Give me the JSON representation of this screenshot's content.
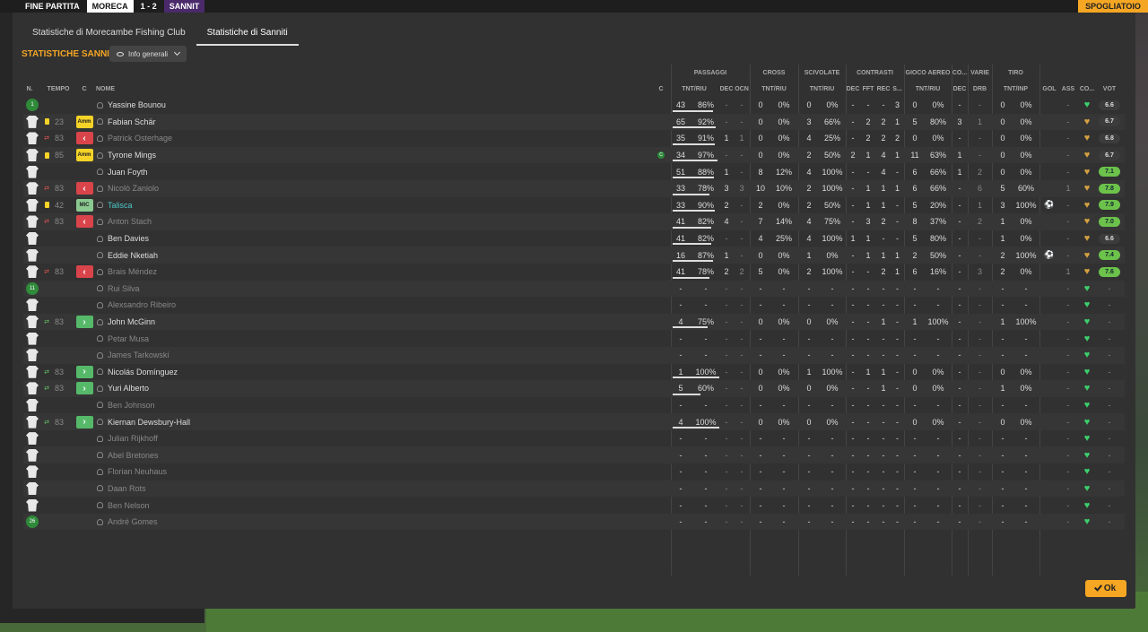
{
  "topbar": {
    "status": "FINE PARTITA",
    "home": "MORECA",
    "score": "1 - 2",
    "away": "SANNIT",
    "right_label": "SPOGLIATOIO"
  },
  "tabs": [
    "Statistiche di Morecambe Fishing Club",
    "Statistiche di Sanniti"
  ],
  "section_title": "STATISTICHE SANNITI",
  "filter_label": "Info generali",
  "group_headers": {
    "passaggi": "PASSAGGI",
    "cross": "CROSS",
    "scivolate": "SCIVOLATE",
    "contrasti": "CONTRASTI",
    "gioco_aereo": "GIOCO AEREO",
    "co": "CO...",
    "varie": "VARIE",
    "tiro": "TIRO"
  },
  "col_headers": {
    "n": "N.",
    "tempo": "TEMPO",
    "c": "C",
    "nome": "NOME",
    "cap": "C",
    "pass_tr": "TNT/RIU",
    "pass_dec": "DEC",
    "pass_ocn": "OCN",
    "cross_tr": "TNT/RIU",
    "sciv_tr": "TNT/RIU",
    "con_dec": "DEC",
    "con_fft": "FFT",
    "con_rec": "REC",
    "con_s": "S...",
    "aer_tr": "TNT/RIU",
    "co_dec": "DEC",
    "drb": "DRB",
    "tiro_ti": "TNT/INP",
    "gol": "GOL",
    "ass": "ASS",
    "co2": "CO...",
    "vot": "VOT"
  },
  "ok_label": "Ok",
  "players": [
    {
      "num": "1",
      "shirt": "gk",
      "tempo": "",
      "card": false,
      "sub": "",
      "pos": "",
      "pos_label": "",
      "name": "Yassine Bounou",
      "dim": false,
      "teal": false,
      "captain": false,
      "p1": "43",
      "p2": "86%",
      "pbar": 86,
      "pdec": "-",
      "pocn": "-",
      "c1": "0",
      "c2": "0%",
      "s1": "0",
      "s2": "0%",
      "cd": "-",
      "cf": "-",
      "cr": "-",
      "cs": "3",
      "a1": "0",
      "a2": "0%",
      "cod": "-",
      "drb": "-",
      "t1": "0",
      "t2": "0%",
      "gol": "",
      "ass": "-",
      "heart": "green",
      "vot": "6.6",
      "votc": "grey"
    },
    {
      "num": "",
      "shirt": "2",
      "tempo": "23",
      "card": true,
      "sub": "",
      "pos": "amm",
      "pos_label": "Amm",
      "name": "Fabian Schär",
      "dim": false,
      "teal": false,
      "captain": false,
      "p1": "65",
      "p2": "92%",
      "pbar": 92,
      "pdec": "-",
      "pocn": "-",
      "c1": "0",
      "c2": "0%",
      "s1": "3",
      "s2": "66%",
      "cd": "-",
      "cf": "2",
      "cr": "2",
      "cs": "1",
      "a1": "5",
      "a2": "80%",
      "cod": "3",
      "drb": "1",
      "t1": "0",
      "t2": "0%",
      "gol": "",
      "ass": "-",
      "heart": "gold",
      "vot": "6.7",
      "votc": "grey"
    },
    {
      "num": "",
      "shirt": "3",
      "tempo": "83",
      "card": false,
      "sub": "out",
      "pos": "out",
      "pos_label": "‹",
      "name": "Patrick Osterhage",
      "dim": true,
      "teal": false,
      "captain": false,
      "p1": "35",
      "p2": "91%",
      "pbar": 91,
      "pdec": "1",
      "pocn": "1",
      "c1": "0",
      "c2": "0%",
      "s1": "4",
      "s2": "25%",
      "cd": "-",
      "cf": "2",
      "cr": "2",
      "cs": "2",
      "a1": "0",
      "a2": "0%",
      "cod": "-",
      "drb": "-",
      "t1": "0",
      "t2": "0%",
      "gol": "",
      "ass": "-",
      "heart": "gold",
      "vot": "6.8",
      "votc": "grey"
    },
    {
      "num": "",
      "shirt": "4",
      "tempo": "85",
      "card": true,
      "sub": "",
      "pos": "amm",
      "pos_label": "Amm",
      "name": "Tyrone Mings",
      "dim": false,
      "teal": false,
      "captain": true,
      "p1": "34",
      "p2": "97%",
      "pbar": 97,
      "pdec": "-",
      "pocn": "-",
      "c1": "0",
      "c2": "0%",
      "s1": "2",
      "s2": "50%",
      "cd": "2",
      "cf": "1",
      "cr": "4",
      "cs": "1",
      "a1": "11",
      "a2": "63%",
      "cod": "1",
      "drb": "-",
      "t1": "0",
      "t2": "0%",
      "gol": "",
      "ass": "-",
      "heart": "gold",
      "vot": "6.7",
      "votc": "grey"
    },
    {
      "num": "",
      "shirt": "5",
      "tempo": "",
      "card": false,
      "sub": "",
      "pos": "",
      "pos_label": "",
      "name": "Juan Foyth",
      "dim": false,
      "teal": false,
      "captain": false,
      "p1": "51",
      "p2": "88%",
      "pbar": 88,
      "pdec": "1",
      "pocn": "-",
      "c1": "8",
      "c2": "12%",
      "s1": "4",
      "s2": "100%",
      "cd": "-",
      "cf": "-",
      "cr": "4",
      "cs": "-",
      "a1": "6",
      "a2": "66%",
      "cod": "1",
      "drb": "2",
      "t1": "0",
      "t2": "0%",
      "gol": "",
      "ass": "-",
      "heart": "gold",
      "vot": "7.1",
      "votc": "green"
    },
    {
      "num": "",
      "shirt": "6",
      "tempo": "83",
      "card": false,
      "sub": "out",
      "pos": "out",
      "pos_label": "‹",
      "name": "Nicolò Zaniolo",
      "dim": true,
      "teal": false,
      "captain": false,
      "p1": "33",
      "p2": "78%",
      "pbar": 78,
      "pdec": "3",
      "pocn": "3",
      "c1": "10",
      "c2": "10%",
      "s1": "2",
      "s2": "100%",
      "cd": "-",
      "cf": "1",
      "cr": "1",
      "cs": "1",
      "a1": "6",
      "a2": "66%",
      "cod": "-",
      "drb": "6",
      "t1": "5",
      "t2": "60%",
      "gol": "",
      "ass": "1",
      "heart": "gold",
      "vot": "7.8",
      "votc": "green"
    },
    {
      "num": "",
      "shirt": "7",
      "tempo": "42",
      "card": true,
      "sub": "",
      "pos": "mic",
      "pos_label": "MIC",
      "name": "Talisca",
      "dim": false,
      "teal": true,
      "captain": false,
      "p1": "33",
      "p2": "90%",
      "pbar": 90,
      "pdec": "2",
      "pocn": "-",
      "c1": "2",
      "c2": "0%",
      "s1": "2",
      "s2": "50%",
      "cd": "-",
      "cf": "1",
      "cr": "1",
      "cs": "-",
      "a1": "5",
      "a2": "20%",
      "cod": "-",
      "drb": "1",
      "t1": "3",
      "t2": "100%",
      "gol": "⚽",
      "ass": "-",
      "heart": "gold",
      "vot": "7.9",
      "votc": "green"
    },
    {
      "num": "",
      "shirt": "8",
      "tempo": "83",
      "card": false,
      "sub": "out",
      "pos": "out",
      "pos_label": "‹",
      "name": "Anton Stach",
      "dim": true,
      "teal": false,
      "captain": false,
      "p1": "41",
      "p2": "82%",
      "pbar": 82,
      "pdec": "4",
      "pocn": "-",
      "c1": "7",
      "c2": "14%",
      "s1": "4",
      "s2": "75%",
      "cd": "-",
      "cf": "3",
      "cr": "2",
      "cs": "-",
      "a1": "8",
      "a2": "37%",
      "cod": "-",
      "drb": "2",
      "t1": "1",
      "t2": "0%",
      "gol": "",
      "ass": "-",
      "heart": "gold",
      "vot": "7.0",
      "votc": "green"
    },
    {
      "num": "",
      "shirt": "9",
      "tempo": "",
      "card": false,
      "sub": "",
      "pos": "",
      "pos_label": "",
      "name": "Ben Davies",
      "dim": false,
      "teal": false,
      "captain": false,
      "p1": "41",
      "p2": "82%",
      "pbar": 82,
      "pdec": "-",
      "pocn": "-",
      "c1": "4",
      "c2": "25%",
      "s1": "4",
      "s2": "100%",
      "cd": "1",
      "cf": "1",
      "cr": "-",
      "cs": "-",
      "a1": "5",
      "a2": "80%",
      "cod": "-",
      "drb": "-",
      "t1": "1",
      "t2": "0%",
      "gol": "",
      "ass": "-",
      "heart": "gold",
      "vot": "6.6",
      "votc": "grey"
    },
    {
      "num": "",
      "shirt": "10",
      "tempo": "",
      "card": false,
      "sub": "",
      "pos": "",
      "pos_label": "",
      "name": "Eddie Nketiah",
      "dim": false,
      "teal": false,
      "captain": false,
      "p1": "16",
      "p2": "87%",
      "pbar": 87,
      "pdec": "1",
      "pocn": "-",
      "c1": "0",
      "c2": "0%",
      "s1": "1",
      "s2": "0%",
      "cd": "-",
      "cf": "1",
      "cr": "1",
      "cs": "1",
      "a1": "2",
      "a2": "50%",
      "cod": "-",
      "drb": "-",
      "t1": "2",
      "t2": "100%",
      "gol": "⚽",
      "ass": "-",
      "heart": "gold",
      "vot": "7.4",
      "votc": "green"
    },
    {
      "num": "",
      "shirt": "11",
      "tempo": "83",
      "card": false,
      "sub": "out",
      "pos": "out",
      "pos_label": "‹",
      "name": "Brais Méndez",
      "dim": true,
      "teal": false,
      "captain": false,
      "p1": "41",
      "p2": "78%",
      "pbar": 78,
      "pdec": "2",
      "pocn": "2",
      "c1": "5",
      "c2": "0%",
      "s1": "2",
      "s2": "100%",
      "cd": "-",
      "cf": "-",
      "cr": "2",
      "cs": "1",
      "a1": "6",
      "a2": "16%",
      "cod": "-",
      "drb": "3",
      "t1": "2",
      "t2": "0%",
      "gol": "",
      "ass": "1",
      "heart": "gold",
      "vot": "7.6",
      "votc": "green"
    },
    {
      "num": "11",
      "shirt": "gk",
      "tempo": "",
      "card": false,
      "sub": "",
      "pos": "",
      "pos_label": "",
      "name": "Rui Silva",
      "dim": true,
      "teal": false,
      "captain": false,
      "p1": "-",
      "p2": "-",
      "pbar": 0,
      "pdec": "-",
      "pocn": "-",
      "c1": "-",
      "c2": "-",
      "s1": "-",
      "s2": "-",
      "cd": "-",
      "cf": "-",
      "cr": "-",
      "cs": "-",
      "a1": "-",
      "a2": "-",
      "cod": "-",
      "drb": "-",
      "t1": "-",
      "t2": "-",
      "gol": "",
      "ass": "-",
      "heart": "green",
      "vot": "-",
      "votc": "none"
    },
    {
      "num": "",
      "shirt": "13",
      "tempo": "",
      "card": false,
      "sub": "",
      "pos": "",
      "pos_label": "",
      "name": "Alexsandro Ribeiro",
      "dim": true,
      "teal": false,
      "captain": false,
      "p1": "-",
      "p2": "-",
      "pbar": 0,
      "pdec": "-",
      "pocn": "-",
      "c1": "-",
      "c2": "-",
      "s1": "-",
      "s2": "-",
      "cd": "-",
      "cf": "-",
      "cr": "-",
      "cs": "-",
      "a1": "-",
      "a2": "-",
      "cod": "-",
      "drb": "-",
      "t1": "-",
      "t2": "-",
      "gol": "",
      "ass": "-",
      "heart": "green",
      "vot": "-",
      "votc": "none"
    },
    {
      "num": "",
      "shirt": "14",
      "tempo": "83",
      "card": false,
      "sub": "in",
      "pos": "in",
      "pos_label": "›",
      "name": "John McGinn",
      "dim": false,
      "teal": false,
      "captain": false,
      "p1": "4",
      "p2": "75%",
      "pbar": 75,
      "pdec": "-",
      "pocn": "-",
      "c1": "0",
      "c2": "0%",
      "s1": "0",
      "s2": "0%",
      "cd": "-",
      "cf": "-",
      "cr": "1",
      "cs": "-",
      "a1": "1",
      "a2": "100%",
      "cod": "-",
      "drb": "-",
      "t1": "1",
      "t2": "100%",
      "gol": "",
      "ass": "-",
      "heart": "green",
      "vot": "-",
      "votc": "none"
    },
    {
      "num": "",
      "shirt": "15",
      "tempo": "",
      "card": false,
      "sub": "",
      "pos": "",
      "pos_label": "",
      "name": "Petar Musa",
      "dim": true,
      "teal": false,
      "captain": false,
      "p1": "-",
      "p2": "-",
      "pbar": 0,
      "pdec": "-",
      "pocn": "-",
      "c1": "-",
      "c2": "-",
      "s1": "-",
      "s2": "-",
      "cd": "-",
      "cf": "-",
      "cr": "-",
      "cs": "-",
      "a1": "-",
      "a2": "-",
      "cod": "-",
      "drb": "-",
      "t1": "-",
      "t2": "-",
      "gol": "",
      "ass": "-",
      "heart": "green",
      "vot": "-",
      "votc": "none"
    },
    {
      "num": "",
      "shirt": "16",
      "tempo": "",
      "card": false,
      "sub": "",
      "pos": "",
      "pos_label": "",
      "name": "James Tarkowski",
      "dim": true,
      "teal": false,
      "captain": false,
      "p1": "-",
      "p2": "-",
      "pbar": 0,
      "pdec": "-",
      "pocn": "-",
      "c1": "-",
      "c2": "-",
      "s1": "-",
      "s2": "-",
      "cd": "-",
      "cf": "-",
      "cr": "-",
      "cs": "-",
      "a1": "-",
      "a2": "-",
      "cod": "-",
      "drb": "-",
      "t1": "-",
      "t2": "-",
      "gol": "",
      "ass": "-",
      "heart": "green",
      "vot": "-",
      "votc": "none"
    },
    {
      "num": "",
      "shirt": "17",
      "tempo": "83",
      "card": false,
      "sub": "in",
      "pos": "in",
      "pos_label": "›",
      "name": "Nicolás Domínguez",
      "dim": false,
      "teal": false,
      "captain": false,
      "p1": "1",
      "p2": "100%",
      "pbar": 100,
      "pdec": "-",
      "pocn": "-",
      "c1": "0",
      "c2": "0%",
      "s1": "1",
      "s2": "100%",
      "cd": "-",
      "cf": "1",
      "cr": "1",
      "cs": "-",
      "a1": "0",
      "a2": "0%",
      "cod": "-",
      "drb": "-",
      "t1": "0",
      "t2": "0%",
      "gol": "",
      "ass": "-",
      "heart": "green",
      "vot": "-",
      "votc": "none"
    },
    {
      "num": "",
      "shirt": "18",
      "tempo": "83",
      "card": false,
      "sub": "in",
      "pos": "in",
      "pos_label": "›",
      "name": "Yuri Alberto",
      "dim": false,
      "teal": false,
      "captain": false,
      "p1": "5",
      "p2": "60%",
      "pbar": 60,
      "pdec": "-",
      "pocn": "-",
      "c1": "0",
      "c2": "0%",
      "s1": "0",
      "s2": "0%",
      "cd": "-",
      "cf": "-",
      "cr": "1",
      "cs": "-",
      "a1": "0",
      "a2": "0%",
      "cod": "-",
      "drb": "-",
      "t1": "1",
      "t2": "0%",
      "gol": "",
      "ass": "-",
      "heart": "green",
      "vot": "-",
      "votc": "none"
    },
    {
      "num": "",
      "shirt": "19",
      "tempo": "",
      "card": false,
      "sub": "",
      "pos": "",
      "pos_label": "",
      "name": "Ben Johnson",
      "dim": true,
      "teal": false,
      "captain": false,
      "p1": "-",
      "p2": "-",
      "pbar": 0,
      "pdec": "-",
      "pocn": "-",
      "c1": "-",
      "c2": "-",
      "s1": "-",
      "s2": "-",
      "cd": "-",
      "cf": "-",
      "cr": "-",
      "cs": "-",
      "a1": "-",
      "a2": "-",
      "cod": "-",
      "drb": "-",
      "t1": "-",
      "t2": "-",
      "gol": "",
      "ass": "-",
      "heart": "green",
      "vot": "-",
      "votc": "none"
    },
    {
      "num": "",
      "shirt": "20",
      "tempo": "83",
      "card": false,
      "sub": "in",
      "pos": "in",
      "pos_label": "›",
      "name": "Kiernan Dewsbury-Hall",
      "dim": false,
      "teal": false,
      "captain": false,
      "p1": "4",
      "p2": "100%",
      "pbar": 100,
      "pdec": "-",
      "pocn": "-",
      "c1": "0",
      "c2": "0%",
      "s1": "0",
      "s2": "0%",
      "cd": "-",
      "cf": "-",
      "cr": "-",
      "cs": "-",
      "a1": "0",
      "a2": "0%",
      "cod": "-",
      "drb": "-",
      "t1": "0",
      "t2": "0%",
      "gol": "",
      "ass": "-",
      "heart": "green",
      "vot": "-",
      "votc": "none"
    },
    {
      "num": "",
      "shirt": "21",
      "tempo": "",
      "card": false,
      "sub": "",
      "pos": "",
      "pos_label": "",
      "name": "Julian Rijkhoff",
      "dim": true,
      "teal": false,
      "captain": false,
      "p1": "-",
      "p2": "-",
      "pbar": 0,
      "pdec": "-",
      "pocn": "-",
      "c1": "-",
      "c2": "-",
      "s1": "-",
      "s2": "-",
      "cd": "-",
      "cf": "-",
      "cr": "-",
      "cs": "-",
      "a1": "-",
      "a2": "-",
      "cod": "-",
      "drb": "-",
      "t1": "-",
      "t2": "-",
      "gol": "",
      "ass": "-",
      "heart": "green",
      "vot": "-",
      "votc": "none"
    },
    {
      "num": "",
      "shirt": "22",
      "tempo": "",
      "card": false,
      "sub": "",
      "pos": "",
      "pos_label": "",
      "name": "Abel Bretones",
      "dim": true,
      "teal": false,
      "captain": false,
      "p1": "-",
      "p2": "-",
      "pbar": 0,
      "pdec": "-",
      "pocn": "-",
      "c1": "-",
      "c2": "-",
      "s1": "-",
      "s2": "-",
      "cd": "-",
      "cf": "-",
      "cr": "-",
      "cs": "-",
      "a1": "-",
      "a2": "-",
      "cod": "-",
      "drb": "-",
      "t1": "-",
      "t2": "-",
      "gol": "",
      "ass": "-",
      "heart": "green",
      "vot": "-",
      "votc": "none"
    },
    {
      "num": "",
      "shirt": "23",
      "tempo": "",
      "card": false,
      "sub": "",
      "pos": "",
      "pos_label": "",
      "name": "Florian Neuhaus",
      "dim": true,
      "teal": false,
      "captain": false,
      "p1": "-",
      "p2": "-",
      "pbar": 0,
      "pdec": "-",
      "pocn": "-",
      "c1": "-",
      "c2": "-",
      "s1": "-",
      "s2": "-",
      "cd": "-",
      "cf": "-",
      "cr": "-",
      "cs": "-",
      "a1": "-",
      "a2": "-",
      "cod": "-",
      "drb": "-",
      "t1": "-",
      "t2": "-",
      "gol": "",
      "ass": "-",
      "heart": "green",
      "vot": "-",
      "votc": "none"
    },
    {
      "num": "",
      "shirt": "24",
      "tempo": "",
      "card": false,
      "sub": "",
      "pos": "",
      "pos_label": "",
      "name": "Daan Rots",
      "dim": true,
      "teal": false,
      "captain": false,
      "p1": "-",
      "p2": "-",
      "pbar": 0,
      "pdec": "-",
      "pocn": "-",
      "c1": "-",
      "c2": "-",
      "s1": "-",
      "s2": "-",
      "cd": "-",
      "cf": "-",
      "cr": "-",
      "cs": "-",
      "a1": "-",
      "a2": "-",
      "cod": "-",
      "drb": "-",
      "t1": "-",
      "t2": "-",
      "gol": "",
      "ass": "-",
      "heart": "green",
      "vot": "-",
      "votc": "none"
    },
    {
      "num": "",
      "shirt": "25",
      "tempo": "",
      "card": false,
      "sub": "",
      "pos": "",
      "pos_label": "",
      "name": "Ben Nelson",
      "dim": true,
      "teal": false,
      "captain": false,
      "p1": "-",
      "p2": "-",
      "pbar": 0,
      "pdec": "-",
      "pocn": "-",
      "c1": "-",
      "c2": "-",
      "s1": "-",
      "s2": "-",
      "cd": "-",
      "cf": "-",
      "cr": "-",
      "cs": "-",
      "a1": "-",
      "a2": "-",
      "cod": "-",
      "drb": "-",
      "t1": "-",
      "t2": "-",
      "gol": "",
      "ass": "-",
      "heart": "green",
      "vot": "-",
      "votc": "none"
    },
    {
      "num": "26",
      "shirt": "gk",
      "tempo": "",
      "card": false,
      "sub": "",
      "pos": "",
      "pos_label": "",
      "name": "André Gomes",
      "dim": true,
      "teal": false,
      "captain": false,
      "p1": "-",
      "p2": "-",
      "pbar": 0,
      "pdec": "-",
      "pocn": "-",
      "c1": "-",
      "c2": "-",
      "s1": "-",
      "s2": "-",
      "cd": "-",
      "cf": "-",
      "cr": "-",
      "cs": "-",
      "a1": "-",
      "a2": "-",
      "cod": "-",
      "drb": "-",
      "t1": "-",
      "t2": "-",
      "gol": "",
      "ass": "-",
      "heart": "green",
      "vot": "-",
      "votc": "none"
    }
  ]
}
